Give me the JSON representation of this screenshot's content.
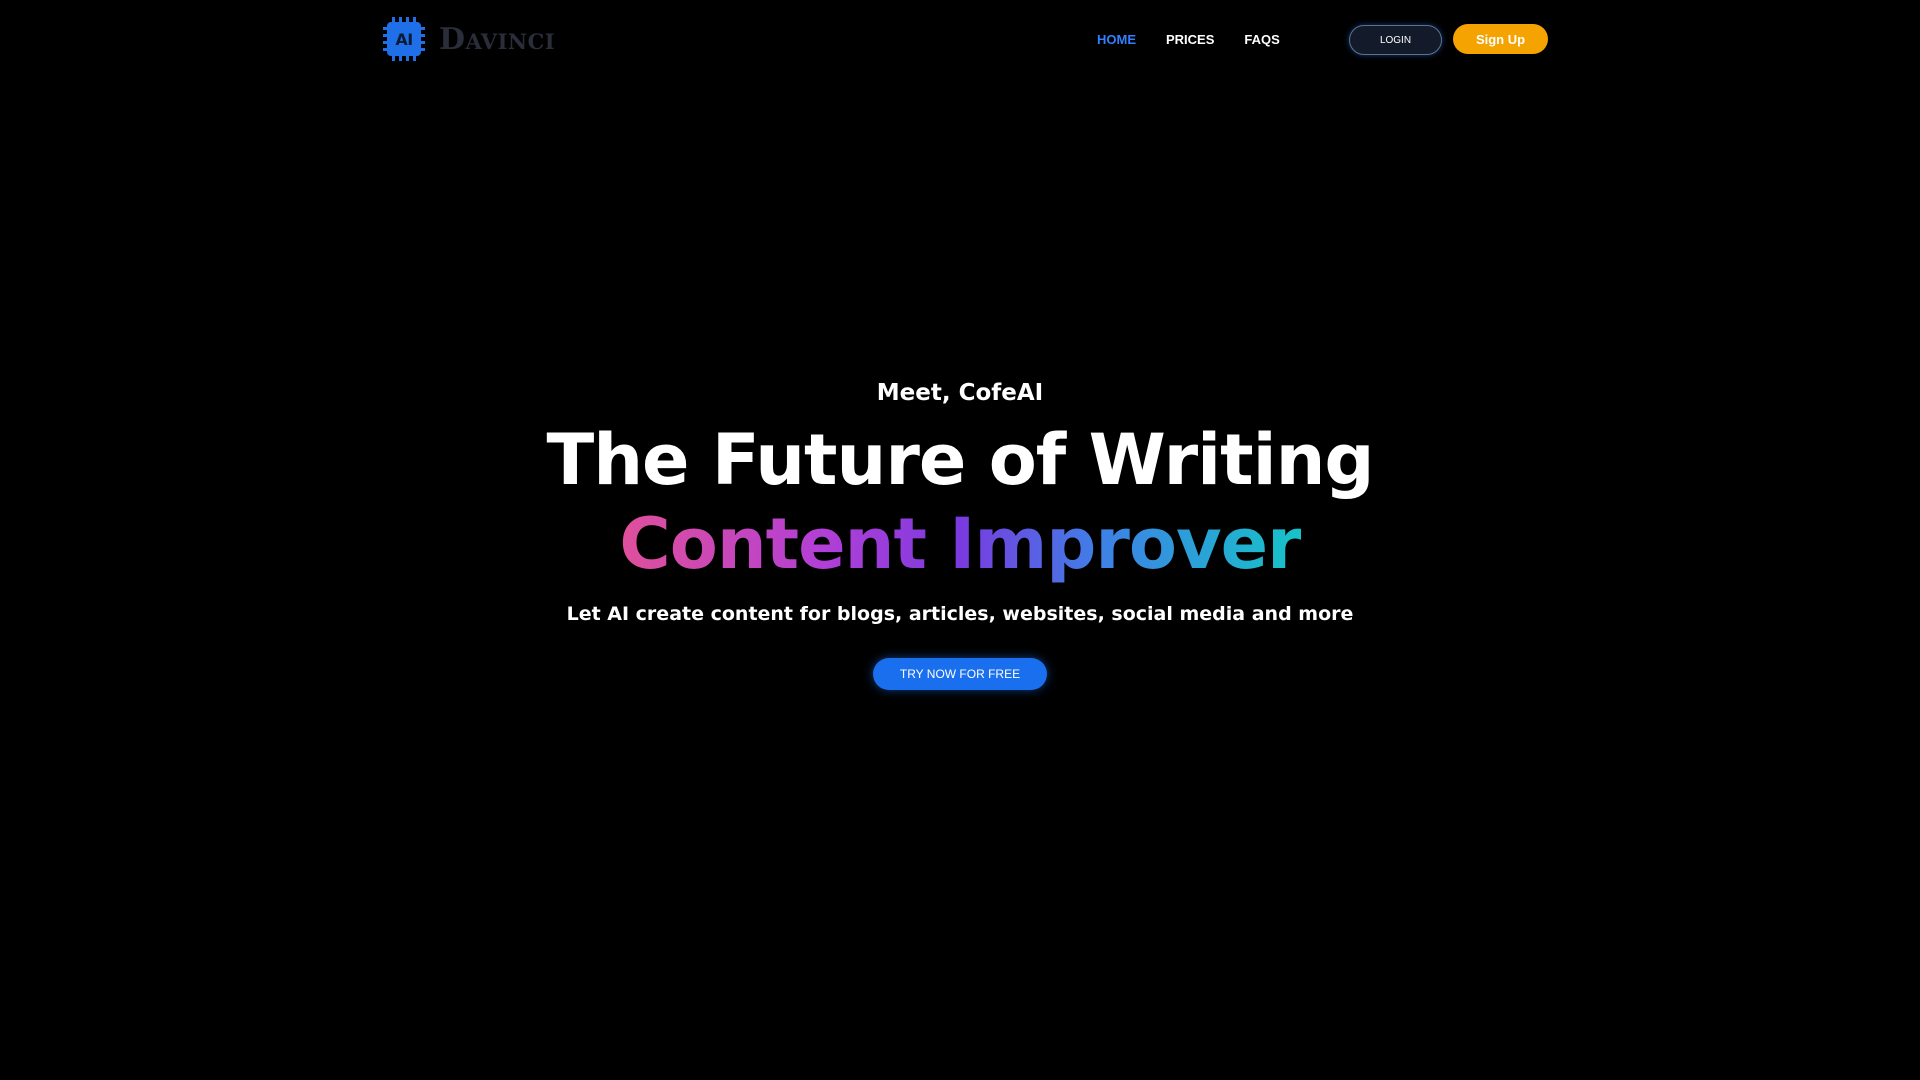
{
  "header": {
    "logo": {
      "chip_text": "AI",
      "wordmark": "Davinci",
      "icon": "ai-chip-icon"
    },
    "nav": [
      {
        "label": "HOME",
        "active": true
      },
      {
        "label": "PRICES",
        "active": false
      },
      {
        "label": "FAQS",
        "active": false
      }
    ],
    "login_label": "LOGIN",
    "signup_label": "Sign Up"
  },
  "hero": {
    "eyebrow": "Meet, CofeAI",
    "title": "The Future of Writing",
    "gradient_text": "Content Improver",
    "subtitle": "Let AI create content for blogs, articles, websites, social media and more",
    "cta_label": "TRY NOW FOR FREE"
  },
  "colors": {
    "background": "#000000",
    "accent_blue": "#1a6fee",
    "nav_active": "#2f80ff",
    "signup_orange": "#f5a300",
    "gradient": [
      "#e0509a",
      "#b23fd6",
      "#7a3ae0",
      "#3f7fe6",
      "#16c4c8"
    ]
  }
}
